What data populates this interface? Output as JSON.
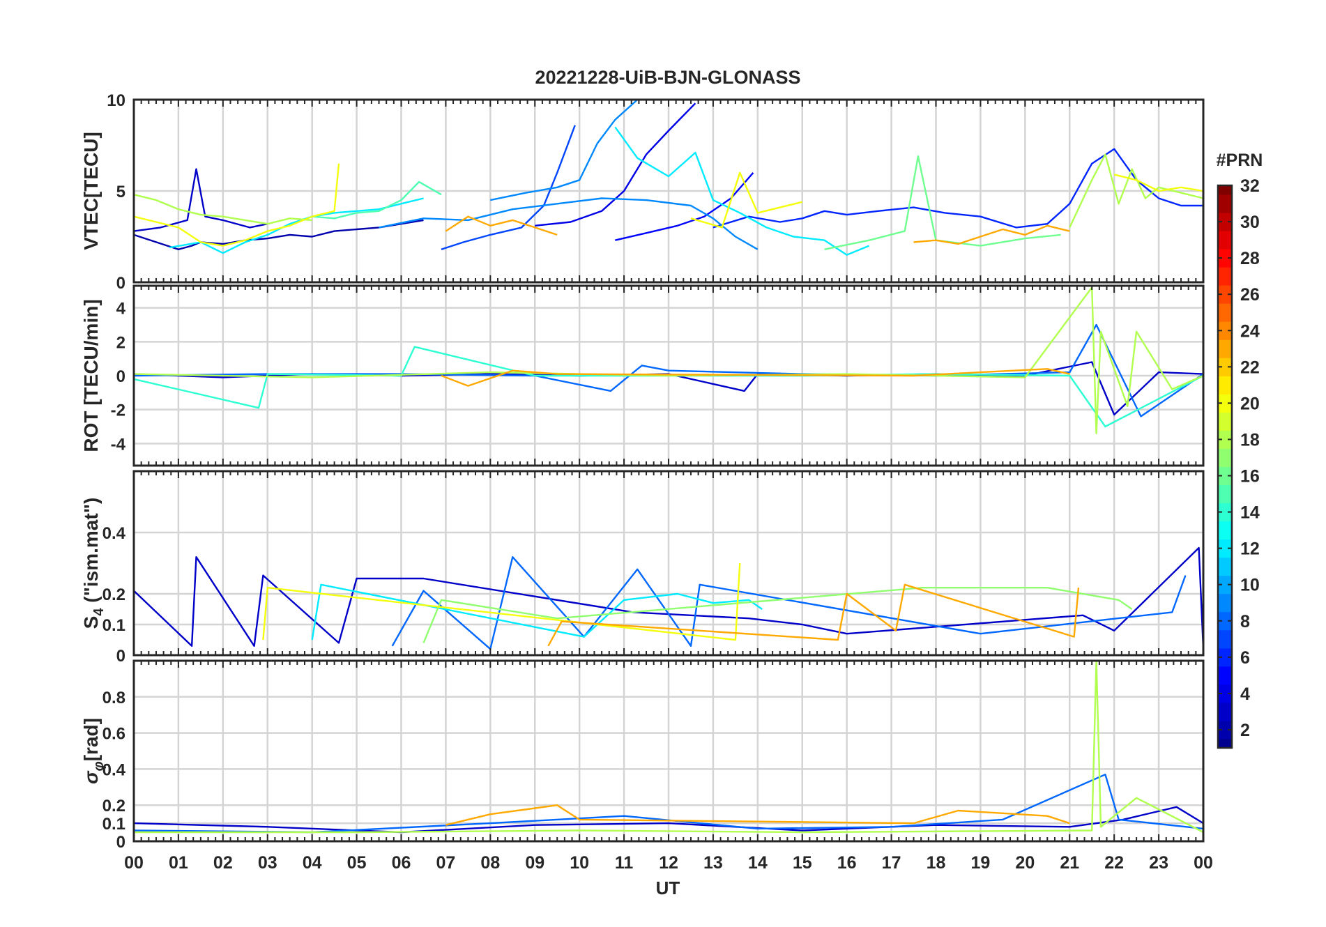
{
  "title": "20221228-UiB-BJN-GLONASS",
  "xlabel": "UT",
  "x_ticks": [
    "00",
    "01",
    "02",
    "03",
    "04",
    "05",
    "06",
    "07",
    "08",
    "09",
    "10",
    "11",
    "12",
    "13",
    "14",
    "15",
    "16",
    "17",
    "18",
    "19",
    "20",
    "21",
    "22",
    "23",
    "00"
  ],
  "colorbar": {
    "label": "#PRN",
    "range": [
      1,
      32
    ],
    "ticks": [
      "2",
      "4",
      "6",
      "8",
      "10",
      "12",
      "14",
      "16",
      "18",
      "20",
      "22",
      "24",
      "26",
      "28",
      "30",
      "32"
    ],
    "colormap": "jet",
    "colors": [
      "#00008f",
      "#0000ff",
      "#0080ff",
      "#00ffff",
      "#80ff80",
      "#ffff00",
      "#ff8000",
      "#ff0000",
      "#800000"
    ]
  },
  "panels": [
    {
      "ylabel": "VTEC[TECU]",
      "ylim": [
        0,
        10
      ],
      "yticks": [
        "0",
        "5",
        "10"
      ]
    },
    {
      "ylabel": "ROT [TECU/min]",
      "ylim": [
        -5.3,
        5.3
      ],
      "yticks": [
        "-4",
        "-2",
        "0",
        "2",
        "4"
      ]
    },
    {
      "ylabel": "S",
      "ylabel_sub": "4",
      "ylabel_rest": " (\"ism.mat\")",
      "ylim": [
        0,
        0.6
      ],
      "yticks": [
        "0",
        "0.1",
        "0.2",
        "0.4"
      ]
    },
    {
      "ylabel": "σ",
      "ylabel_sub": "φ",
      "ylabel_rest": "[rad]",
      "ylim": [
        0,
        1.0
      ],
      "yticks": [
        "0",
        "0.1",
        "0.2",
        "0.4",
        "0.6",
        "0.8"
      ]
    }
  ],
  "chart_data": {
    "type": "line",
    "title": "20221228-UiB-BJN-GLONASS",
    "xlabel": "UT",
    "x_range_hours": [
      0,
      24
    ],
    "subplots": [
      {
        "ylabel": "VTEC[TECU]",
        "ylim": [
          0,
          10
        ],
        "series": [
          {
            "prn": 2,
            "x": [
              0,
              0.5,
              1.0,
              1.3,
              1.5,
              2.0,
              2.5,
              3.0,
              3.5,
              4.0,
              4.5,
              5.0,
              5.5,
              6.0,
              6.5
            ],
            "y": [
              2.6,
              2.2,
              1.8,
              2.0,
              2.2,
              2.1,
              2.3,
              2.4,
              2.6,
              2.5,
              2.8,
              2.9,
              3.0,
              3.2,
              3.4
            ]
          },
          {
            "prn": 3,
            "x": [
              0,
              0.6,
              1.2,
              1.4,
              1.6,
              2.0,
              2.6,
              3.0
            ],
            "y": [
              2.8,
              3.0,
              3.4,
              6.2,
              3.6,
              3.4,
              3.0,
              3.2
            ]
          },
          {
            "prn": 4,
            "x": [
              9.0,
              9.8,
              10.5,
              11.0,
              11.5,
              12.0,
              12.6
            ],
            "y": [
              3.1,
              3.3,
              3.9,
              5.0,
              7.0,
              8.3,
              9.8
            ]
          },
          {
            "prn": 5,
            "x": [
              10.8,
              11.5,
              12.2,
              12.8,
              13.4,
              13.9
            ],
            "y": [
              2.3,
              2.7,
              3.1,
              3.6,
              4.6,
              6.0
            ]
          },
          {
            "prn": 6,
            "x": [
              13.0,
              13.8,
              14.5,
              15.0,
              15.5,
              16.0,
              16.7,
              17.5,
              18.2,
              19.0,
              19.8,
              20.5,
              21.0,
              21.5,
              22.0,
              22.5,
              23.0,
              23.5,
              24.0
            ],
            "y": [
              3.0,
              3.6,
              3.3,
              3.5,
              3.9,
              3.7,
              3.9,
              4.1,
              3.8,
              3.6,
              3.0,
              3.2,
              4.3,
              6.5,
              7.3,
              5.6,
              4.6,
              4.2,
              4.2
            ]
          },
          {
            "prn": 7,
            "x": [
              6.9,
              7.4,
              8.0,
              8.7,
              9.2,
              9.5,
              9.9
            ],
            "y": [
              1.8,
              2.2,
              2.6,
              3.0,
              4.2,
              6.0,
              8.6
            ]
          },
          {
            "prn": 9,
            "x": [
              8.0,
              8.8,
              9.5,
              10.0,
              10.4,
              10.8,
              11.3
            ],
            "y": [
              4.5,
              4.9,
              5.2,
              5.6,
              7.6,
              8.9,
              10.0
            ]
          },
          {
            "prn": 9,
            "x": [
              5.5,
              6.5,
              7.5,
              8.5,
              9.5,
              10.5,
              11.5,
              12.5,
              13.0,
              13.5,
              14.0
            ],
            "y": [
              3.0,
              3.5,
              3.4,
              4.0,
              4.3,
              4.6,
              4.5,
              4.2,
              3.5,
              2.5,
              1.8
            ]
          },
          {
            "prn": 12,
            "x": [
              10.8,
              11.3,
              12.0,
              12.6,
              13.0,
              13.6,
              14.2,
              14.8,
              15.5,
              16.0,
              16.5
            ],
            "y": [
              8.5,
              6.8,
              5.8,
              7.1,
              4.5,
              3.8,
              3.0,
              2.5,
              2.3,
              1.5,
              2.0
            ]
          },
          {
            "prn": 12,
            "x": [
              0.8,
              1.5,
              2.0,
              2.5,
              3.0,
              3.5,
              4.0,
              4.5,
              5.0,
              5.5,
              6.0,
              6.5
            ],
            "y": [
              1.9,
              2.2,
              1.6,
              2.2,
              2.6,
              3.2,
              3.6,
              3.8,
              3.9,
              4.0,
              4.3,
              4.6
            ]
          },
          {
            "prn": 15,
            "x": [
              4.0,
              4.5,
              5.0,
              5.5,
              6.0,
              6.4,
              6.9
            ],
            "y": [
              3.6,
              3.5,
              3.8,
              3.9,
              4.5,
              5.5,
              4.8
            ]
          },
          {
            "prn": 16,
            "x": [
              15.5,
              16.5,
              17.3,
              17.6,
              18.0,
              19.0,
              20.0,
              20.8
            ],
            "y": [
              1.8,
              2.3,
              2.8,
              6.9,
              2.3,
              2.0,
              2.4,
              2.6
            ]
          },
          {
            "prn": 18,
            "x": [
              0,
              0.5,
              1.0,
              1.5,
              2.0,
              2.5,
              3.0,
              3.5,
              4.0
            ],
            "y": [
              4.8,
              4.5,
              4.0,
              3.7,
              3.6,
              3.4,
              3.2,
              3.5,
              3.4
            ]
          },
          {
            "prn": 18,
            "x": [
              21.0,
              21.5,
              21.8,
              22.1,
              22.4,
              22.7,
              23.0,
              23.5,
              24.0
            ],
            "y": [
              3.0,
              5.6,
              7.0,
              4.3,
              6.2,
              4.6,
              5.2,
              4.9,
              4.6
            ]
          },
          {
            "prn": 20,
            "x": [
              0,
              0.5,
              1.0,
              1.5,
              2.0,
              2.5,
              3.0,
              3.5,
              4.0,
              4.5,
              4.6
            ],
            "y": [
              3.6,
              3.3,
              3.0,
              2.2,
              2.0,
              2.3,
              2.8,
              3.1,
              3.6,
              3.9,
              6.5
            ]
          },
          {
            "prn": 20,
            "x": [
              12.5,
              13.2,
              13.6,
              14.0,
              14.5,
              15.0
            ],
            "y": [
              3.5,
              3.0,
              6.0,
              3.8,
              4.1,
              4.4
            ]
          },
          {
            "prn": 20,
            "x": [
              22.0,
              22.5,
              23.0,
              23.5,
              24.0
            ],
            "y": [
              5.9,
              5.6,
              5.0,
              5.2,
              5.0
            ]
          },
          {
            "prn": 23,
            "x": [
              7.0,
              7.5,
              8.0,
              8.5,
              9.0,
              9.5
            ],
            "y": [
              2.8,
              3.6,
              3.1,
              3.4,
              3.0,
              2.6
            ]
          },
          {
            "prn": 23,
            "x": [
              17.5,
              18.0,
              18.5,
              19.0,
              19.5,
              20.0,
              20.5,
              21.0
            ],
            "y": [
              2.2,
              2.3,
              2.1,
              2.5,
              2.9,
              2.6,
              3.1,
              2.8
            ]
          }
        ]
      },
      {
        "ylabel": "ROT [TECU/min]",
        "ylim": [
          -5.3,
          5.3
        ],
        "series": [
          {
            "prn": 3,
            "x": [
              0,
              2,
              4,
              6,
              8,
              10,
              12,
              13.7,
              14,
              16,
              18,
              20,
              21.5,
              22,
              23,
              24
            ],
            "y": [
              0.1,
              -0.1,
              0.1,
              0,
              0.1,
              0,
              0.1,
              -0.9,
              0.1,
              0,
              0.1,
              0,
              0.8,
              -2.3,
              0.2,
              0.1
            ]
          },
          {
            "prn": 8,
            "x": [
              0,
              3,
              6,
              9,
              10.7,
              11.4,
              12,
              15,
              18,
              21,
              21.6,
              22.6,
              24
            ],
            "y": [
              0,
              0.1,
              0.1,
              0,
              -0.9,
              0.6,
              0.3,
              0.1,
              0,
              0.2,
              3.0,
              -2.4,
              0.1
            ]
          },
          {
            "prn": 14,
            "x": [
              0,
              2.8,
              3,
              6,
              6.3,
              9,
              12,
              15,
              18,
              21,
              21.8,
              24
            ],
            "y": [
              -0.2,
              -1.9,
              0.1,
              0,
              1.7,
              0,
              0,
              0,
              0.1,
              0,
              -3.0,
              0
            ]
          },
          {
            "prn": 18,
            "x": [
              0,
              4,
              8,
              12,
              16,
              20,
              21.5,
              21.6,
              21.7,
              22.3,
              22.5,
              23.3,
              24
            ],
            "y": [
              0.1,
              -0.1,
              0.2,
              0,
              0.1,
              -0.1,
              5.2,
              -3.4,
              2.6,
              -1.8,
              2.6,
              -0.8,
              0
            ]
          },
          {
            "prn": 23,
            "x": [
              6.9,
              7.5,
              8.5,
              9.5,
              17.5,
              19,
              20.5,
              21
            ],
            "y": [
              0,
              -0.6,
              0.3,
              0.1,
              0,
              0.2,
              0.4,
              0.1
            ]
          }
        ]
      },
      {
        "ylabel": "S4 (\"ism.mat\")",
        "ylim": [
          0,
          0.6
        ],
        "series": [
          {
            "prn": 3,
            "x": [
              0,
              1.3,
              1.4,
              2.7,
              2.9,
              4.6,
              5.0,
              6.5,
              11.2,
              13.8,
              15.0,
              16.0,
              21.3,
              22.0,
              23.9,
              24
            ],
            "y": [
              0.21,
              0.03,
              0.32,
              0.03,
              0.26,
              0.04,
              0.25,
              0.25,
              0.14,
              0.12,
              0.1,
              0.07,
              0.13,
              0.08,
              0.35,
              0.02
            ]
          },
          {
            "prn": 8,
            "x": [
              5.8,
              6.5,
              8.0,
              8.5,
              10.1,
              11.3,
              12.5,
              12.7,
              19.0,
              23.3,
              23.6
            ],
            "y": [
              0.03,
              0.21,
              0.02,
              0.32,
              0.06,
              0.28,
              0.03,
              0.23,
              0.07,
              0.14,
              0.26
            ]
          },
          {
            "prn": 12,
            "x": [
              4.0,
              4.2,
              10.1,
              11.0,
              12.2,
              13.0,
              13.8,
              14.1
            ],
            "y": [
              0.05,
              0.23,
              0.06,
              0.18,
              0.2,
              0.17,
              0.18,
              0.15
            ]
          },
          {
            "prn": 17,
            "x": [
              6.5,
              6.9,
              9.5,
              17.7,
              19.2,
              20.5,
              22.1,
              22.4
            ],
            "y": [
              0.04,
              0.18,
              0.12,
              0.22,
              0.22,
              0.22,
              0.18,
              0.15
            ]
          },
          {
            "prn": 20,
            "x": [
              2.9,
              3.0,
              13.5,
              13.6
            ],
            "y": [
              0.05,
              0.22,
              0.05,
              0.3
            ]
          },
          {
            "prn": 23,
            "x": [
              9.3,
              9.6,
              15.8,
              16.0,
              17.1,
              17.3,
              21.1,
              21.2
            ],
            "y": [
              0.03,
              0.11,
              0.05,
              0.2,
              0.08,
              0.23,
              0.06,
              0.22
            ]
          }
        ]
      },
      {
        "ylabel": "σφ[rad]",
        "ylim": [
          0,
          1.0
        ],
        "series": [
          {
            "prn": 3,
            "x": [
              0,
              3,
              6,
              9,
              12,
              15,
              18,
              21,
              22.2,
              23.4,
              24
            ],
            "y": [
              0.1,
              0.08,
              0.05,
              0.09,
              0.1,
              0.06,
              0.09,
              0.08,
              0.12,
              0.19,
              0.1
            ]
          },
          {
            "prn": 8,
            "x": [
              0,
              4,
              8,
              11,
              14,
              17,
              19.5,
              21.8,
              22.1,
              24
            ],
            "y": [
              0.06,
              0.05,
              0.1,
              0.14,
              0.07,
              0.08,
              0.12,
              0.37,
              0.12,
              0.07
            ]
          },
          {
            "prn": 18,
            "x": [
              0,
              5,
              10,
              15,
              21.5,
              21.6,
              21.7,
              22.5,
              24
            ],
            "y": [
              0.05,
              0.05,
              0.06,
              0.05,
              0.06,
              1.0,
              0.08,
              0.24,
              0.05
            ]
          },
          {
            "prn": 23,
            "x": [
              7,
              8,
              9.5,
              10,
              17.5,
              18.5,
              20.5,
              21
            ],
            "y": [
              0.09,
              0.15,
              0.2,
              0.12,
              0.1,
              0.17,
              0.14,
              0.1
            ]
          }
        ]
      }
    ]
  }
}
